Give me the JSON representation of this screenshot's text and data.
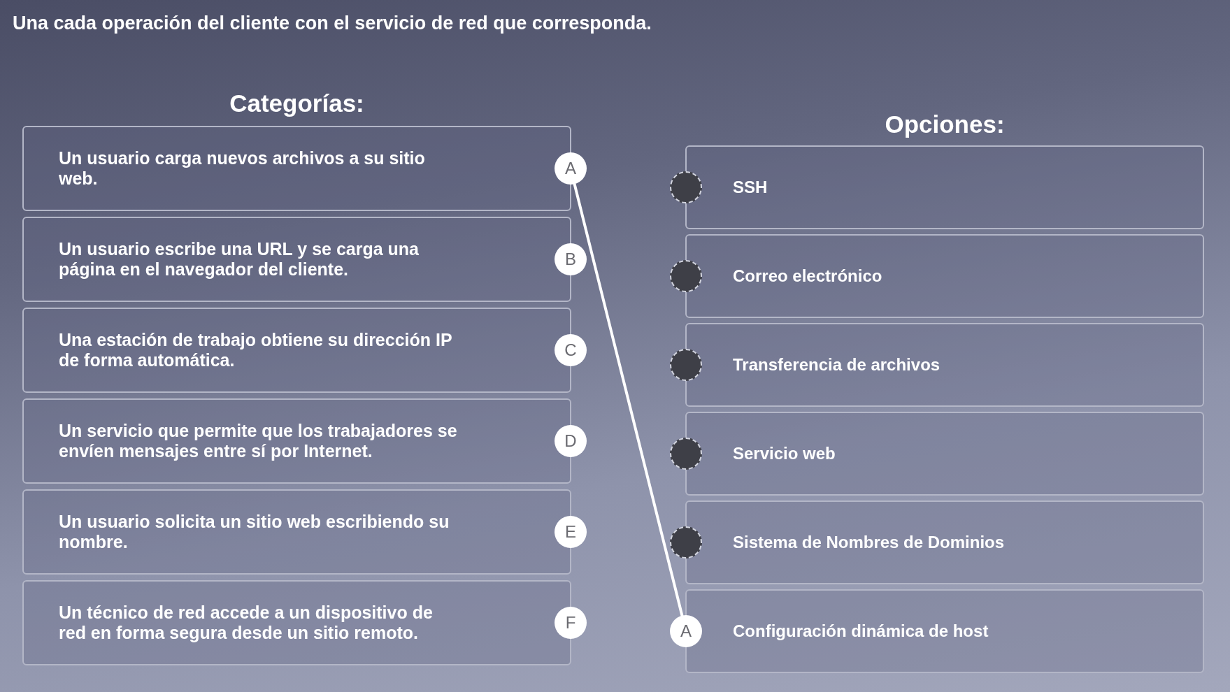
{
  "instruction": "Una cada operación del cliente con el servicio de red que corresponda.",
  "categories": {
    "heading": "Categorías:",
    "items": [
      {
        "letter": "A",
        "text": "Un usuario carga nuevos archivos a su sitio web.",
        "connected": true
      },
      {
        "letter": "B",
        "text": "Un usuario escribe una URL y se carga una página en el navegador del cliente.",
        "connected": false
      },
      {
        "letter": "C",
        "text": "Una estación de trabajo obtiene su dirección IP de forma automática.",
        "connected": false
      },
      {
        "letter": "D",
        "text": "Un servicio que permite que los trabajadores se envíen mensajes entre sí por Internet.",
        "connected": false
      },
      {
        "letter": "E",
        "text": "Un usuario solicita un sitio web escribiendo su nombre.",
        "connected": false
      },
      {
        "letter": "F",
        "text": "Un técnico de red accede a un dispositivo de red en forma segura desde un sitio remoto.",
        "connected": false
      }
    ]
  },
  "options": {
    "heading": "Opciones:",
    "items": [
      {
        "kind": "empty",
        "text": "SSH"
      },
      {
        "kind": "empty",
        "text": "Correo electrónico"
      },
      {
        "kind": "empty",
        "text": "Transferencia de archivos"
      },
      {
        "kind": "empty",
        "text": "Servicio web"
      },
      {
        "kind": "empty",
        "text": "Sistema de Nombres de Dominios"
      },
      {
        "kind": "attached",
        "letter": "A",
        "text": "Configuración dinámica de host"
      }
    ]
  }
}
